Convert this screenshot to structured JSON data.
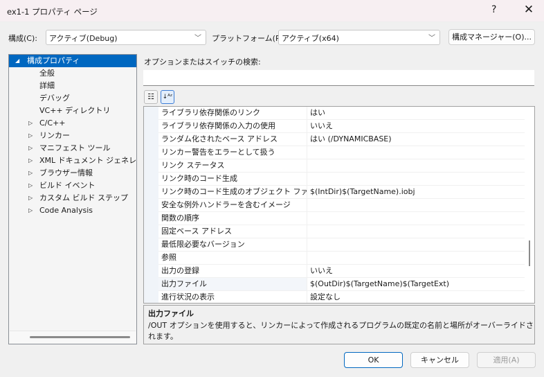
{
  "window": {
    "title": "ex1-1 プロパティ ページ",
    "help": "?",
    "close": "✕"
  },
  "config": {
    "label": "構成(C):",
    "value": "アクティブ(Debug)",
    "platform_label": "プラットフォーム(P):",
    "platform_value": "アクティブ(x64)",
    "manager_button": "構成マネージャー(O)..."
  },
  "tree": {
    "items": [
      {
        "label": "構成プロパティ",
        "expander": "◢",
        "selected": true
      },
      {
        "label": "全般"
      },
      {
        "label": "詳細"
      },
      {
        "label": "デバッグ"
      },
      {
        "label": "VC++ ディレクトリ"
      },
      {
        "label": "C/C++",
        "expander": "▷"
      },
      {
        "label": "リンカー",
        "expander": "▷"
      },
      {
        "label": "マニフェスト ツール",
        "expander": "▷"
      },
      {
        "label": "XML ドキュメント ジェネレーター",
        "expander": "▷"
      },
      {
        "label": "ブラウザー情報",
        "expander": "▷"
      },
      {
        "label": "ビルド イベント",
        "expander": "▷"
      },
      {
        "label": "カスタム ビルド ステップ",
        "expander": "▷"
      },
      {
        "label": "Code Analysis",
        "expander": "▷"
      }
    ]
  },
  "search": {
    "label": "オプションまたはスイッチの検索:",
    "value": ""
  },
  "toolbar": {
    "categorized_icon": "☷",
    "alphabetical_icon": "↓ᴬᶻ"
  },
  "properties": [
    {
      "name": "ライブラリ依存関係のリンク",
      "value": "はい"
    },
    {
      "name": "ライブラリ依存関係の入力の使用",
      "value": "いいえ"
    },
    {
      "name": "ランダム化されたベース アドレス",
      "value": "はい (/DYNAMICBASE)"
    },
    {
      "name": "リンカー警告をエラーとして扱う",
      "value": ""
    },
    {
      "name": "リンク ステータス",
      "value": ""
    },
    {
      "name": "リンク時のコード生成",
      "value": ""
    },
    {
      "name": "リンク時のコード生成のオブジェクト ファイル",
      "value": "$(IntDir)$(TargetName).iobj"
    },
    {
      "name": "安全な例外ハンドラーを含むイメージ",
      "value": ""
    },
    {
      "name": "関数の順序",
      "value": ""
    },
    {
      "name": "固定ベース アドレス",
      "value": ""
    },
    {
      "name": "最低限必要なバージョン",
      "value": ""
    },
    {
      "name": "参照",
      "value": ""
    },
    {
      "name": "出力の登録",
      "value": "いいえ"
    },
    {
      "name": "出力ファイル",
      "value": "$(OutDir)$(TargetName)$(TargetExt)",
      "selected": true
    },
    {
      "name": "進行状況の表示",
      "value": "設定なし"
    }
  ],
  "description": {
    "title": "出力ファイル",
    "text": "/OUT オプションを使用すると、リンカーによって作成されるプログラムの既定の名前と場所がオーバーライドされます。"
  },
  "buttons": {
    "ok": "OK",
    "cancel": "キャンセル",
    "apply": "適用(A)"
  },
  "colors": {
    "selection": "#0067c0"
  }
}
